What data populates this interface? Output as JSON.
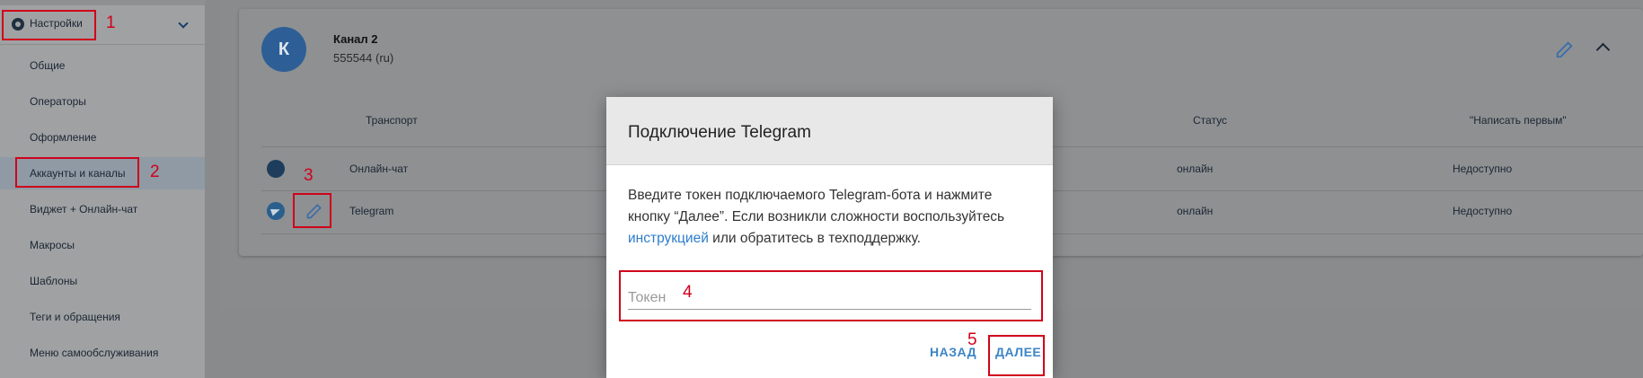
{
  "sidebar": {
    "section_label": "Настройки",
    "items": [
      {
        "label": "Общие"
      },
      {
        "label": "Операторы"
      },
      {
        "label": "Оформление"
      },
      {
        "label": "Аккаунты и каналы"
      },
      {
        "label": "Виджет + Онлайн-чат"
      },
      {
        "label": "Макросы"
      },
      {
        "label": "Шаблоны"
      },
      {
        "label": "Теги и обращения"
      },
      {
        "label": "Меню самообслуживания"
      }
    ]
  },
  "channel": {
    "avatar_letter": "К",
    "name": "Канал 2",
    "subtitle": "555544 (ru)"
  },
  "table": {
    "headers": {
      "transport": "Транспорт",
      "status": "Статус",
      "write_first": "\"Написать первым\""
    },
    "rows": [
      {
        "transport": "Онлайн-чат",
        "status": "онлайн",
        "write_first": "Недоступно"
      },
      {
        "transport": "Telegram",
        "status": "онлайн",
        "write_first": "Недоступно"
      }
    ]
  },
  "dialog": {
    "title": "Подключение Telegram",
    "body_before": "Введите токен подключаемого Telegram-бота и нажмите кнопку “Далее”. Если возникли сложности воспользуйтесь ",
    "body_link": "инструкцией",
    "body_after": " или обратитесь в техподдержку.",
    "token_placeholder": "Токен",
    "back_label": "НАЗАД",
    "next_label": "ДАЛЕЕ"
  },
  "annotations": [
    "1",
    "2",
    "3",
    "4",
    "5"
  ],
  "colors": {
    "accent": "#3d85c6",
    "highlight": "#d0021b",
    "avatar": "#2d5f96"
  }
}
